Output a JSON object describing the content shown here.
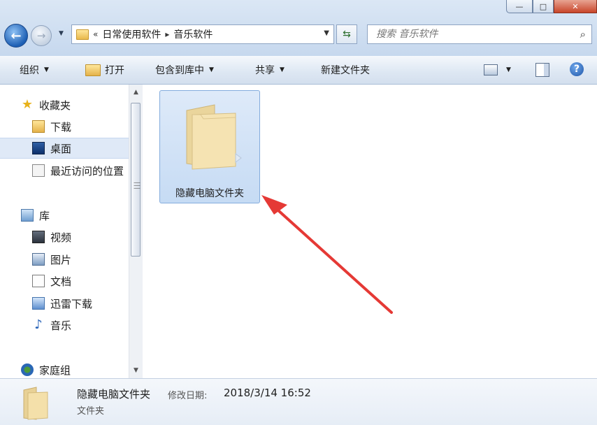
{
  "window": {
    "controls": {
      "minimize": "—",
      "maximize": "□",
      "close": "✕"
    }
  },
  "address_bar": {
    "prefix": "«",
    "crumbs": [
      "日常使用软件",
      "音乐软件"
    ],
    "separator": "▸"
  },
  "search": {
    "placeholder": "搜索 音乐软件"
  },
  "toolbar": {
    "organize": "组织",
    "open": "打开",
    "include_in_library": "包含到库中",
    "share": "共享",
    "new_folder": "新建文件夹"
  },
  "nav_pane": {
    "favorites": {
      "label": "收藏夹",
      "items": [
        "下载",
        "桌面",
        "最近访问的位置"
      ]
    },
    "libraries": {
      "label": "库",
      "items": [
        "视频",
        "图片",
        "文档",
        "迅雷下载",
        "音乐"
      ]
    },
    "homegroup": {
      "label": "家庭组"
    },
    "selected": "桌面"
  },
  "content": {
    "items": [
      {
        "name": "隐藏电脑文件夹",
        "type": "folder",
        "selected": true
      }
    ]
  },
  "details_pane": {
    "name": "隐藏电脑文件夹",
    "modified_label": "修改日期:",
    "modified_value": "2018/3/14 16:52",
    "type": "文件夹"
  },
  "colors": {
    "selection": "#c6dbf4",
    "arrow": "#e53935",
    "folder": "#f3deaa"
  },
  "icons": {
    "back": "back-arrow-icon",
    "forward": "forward-arrow-icon",
    "refresh": "refresh-icon",
    "search": "magnifier-icon",
    "help": "help-icon"
  }
}
